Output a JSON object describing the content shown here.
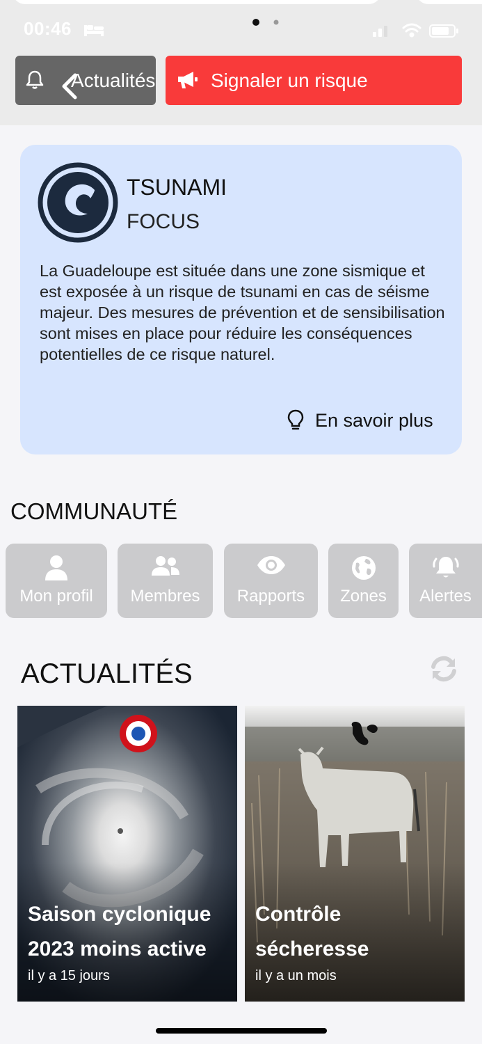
{
  "status_bar": {
    "time": "00:46"
  },
  "header": {
    "news_button": "Actualités",
    "report_button": "Signaler un risque"
  },
  "focus": {
    "title": "TSUNAMI",
    "subtitle": "FOCUS",
    "text": "La Guadeloupe est située dans une zone sismique et est exposée à un risque de tsunami en cas de séisme majeur. Des mesures de prévention et de sensibilisation sont mises en place pour réduire les conséquences potentielles de ce risque naturel.",
    "learn_more": "En savoir plus"
  },
  "community": {
    "title": "COMMUNAUTÉ",
    "items": [
      {
        "label": "Mon profil",
        "icon": "user-icon"
      },
      {
        "label": "Membres",
        "icon": "users-icon"
      },
      {
        "label": "Rapports",
        "icon": "eye-icon"
      },
      {
        "label": "Zones",
        "icon": "globe-icon"
      },
      {
        "label": "Alertes",
        "icon": "bell-icon"
      }
    ]
  },
  "news": {
    "title": "ACTUALITÉS",
    "cards": [
      {
        "title": "Saison cyclonique 2023 moins active",
        "ago": "il y a 15 jours"
      },
      {
        "title": "Contrôle sécheresse",
        "ago": "il y a un mois"
      }
    ]
  },
  "colors": {
    "accent_red": "#f93a3a",
    "news_button_grey": "#666666",
    "focus_card_bg": "#d7e5fe",
    "tile_grey": "#cbcbcd"
  }
}
